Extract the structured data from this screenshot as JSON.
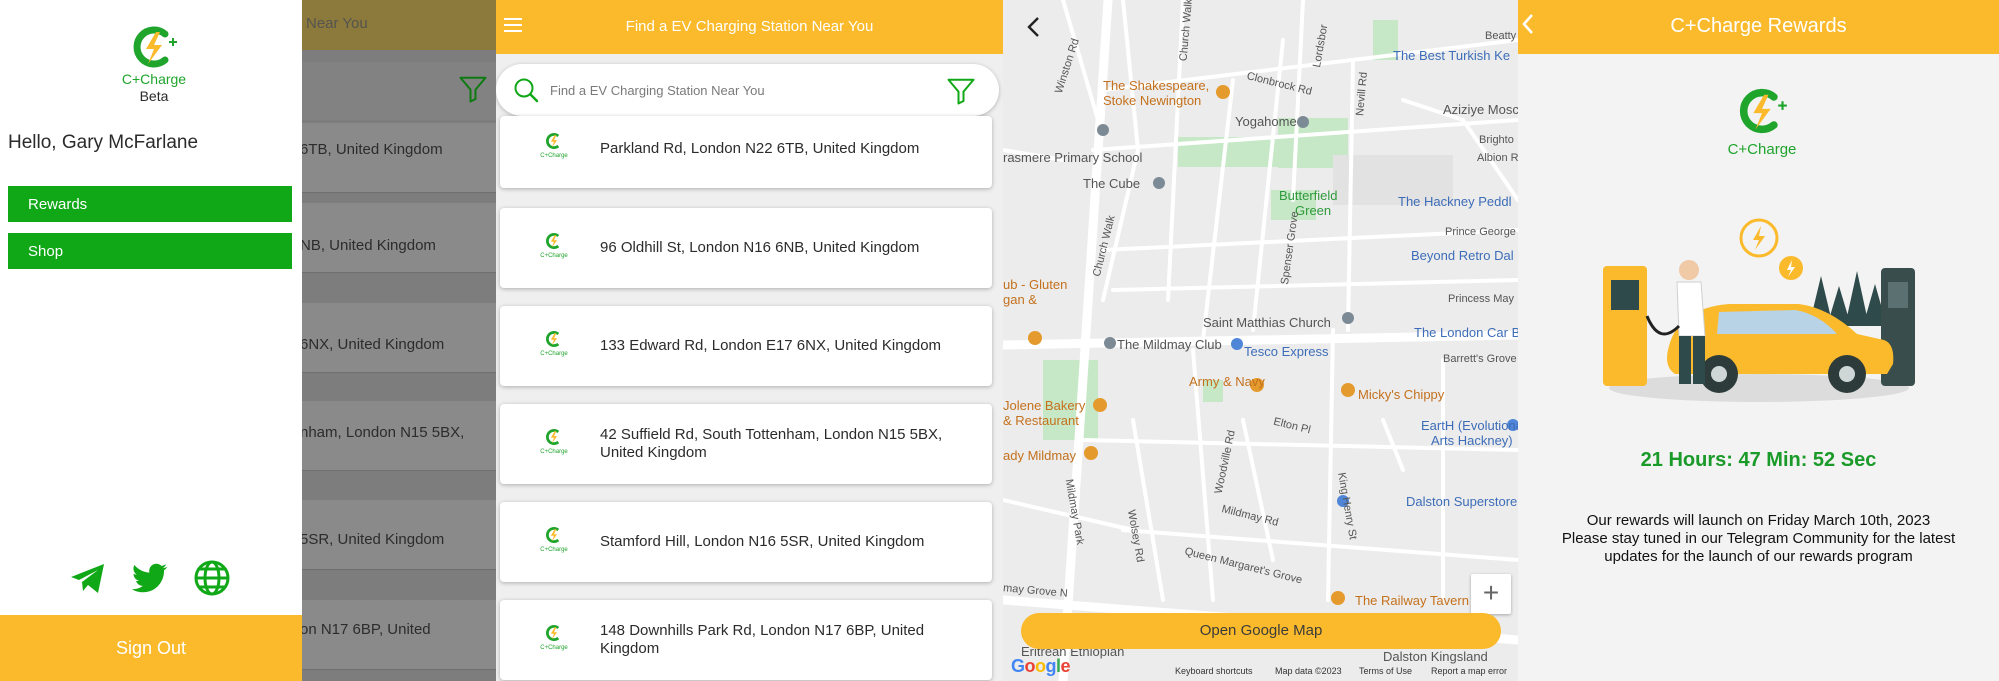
{
  "colors": {
    "accent": "#fbba2b",
    "brand_green": "#11a817",
    "logo_green": "#1fa42c",
    "map_background": "#ececec",
    "park_green": "#c6e8c6"
  },
  "brand": {
    "name": "C+Charge",
    "tag": "Beta"
  },
  "drawer": {
    "greeting": "Hello, Gary McFarlane",
    "menu": [
      {
        "label": "Rewards"
      },
      {
        "label": "Shop"
      }
    ],
    "social_icons": [
      "telegram-icon",
      "twitter-icon",
      "globe-icon"
    ],
    "sign_out": "Sign Out"
  },
  "background_list": {
    "header_fragment": "Near You",
    "items": [
      "6TB, United Kingdom",
      "NB, United Kingdom",
      "6NX, United Kingdom",
      "nham, London N15 5BX,",
      "5SR, United Kingdom",
      "on N17 6BP, United"
    ]
  },
  "list_screen": {
    "title": "Find a EV Charging Station Near You",
    "search_placeholder": "Find a EV Charging Station Near You",
    "stations": [
      {
        "lines": [
          "Parkland Rd, London N22 6TB, United Kingdom"
        ]
      },
      {
        "lines": [
          "96 Oldhill St, London N16 6NB, United Kingdom"
        ]
      },
      {
        "lines": [
          "133 Edward Rd, London E17 6NX, United Kingdom"
        ]
      },
      {
        "lines": [
          "42 Suffield Rd, South Tottenham, London N15 5BX,",
          "United Kingdom"
        ]
      },
      {
        "lines": [
          "Stamford Hill, London N16 5SR, United Kingdom"
        ]
      },
      {
        "lines": [
          "148 Downhills Park Rd, London N17 6BP, United",
          "Kingdom"
        ]
      }
    ]
  },
  "map_screen": {
    "labels": {
      "best_turkish": "The Best Turkish Ke",
      "shakespeare_1": "The Shakespeare,",
      "shakespeare_2": "Stoke Newington",
      "yogahome": "Yogahome",
      "aziziye": "Aziziye Mosc",
      "grasmere": "rasmere Primary School",
      "the_cube": "The Cube",
      "butterfield_1": "Butterfield",
      "butterfield_2": "Green",
      "hackney_peddler": "The Hackney Peddl",
      "beyond_retro": "Beyond Retro Dal",
      "gluten_1": "ub - Gluten",
      "gluten_2": "gan &",
      "saint_matthias": "Saint Matthias Church",
      "london_car_boot": "The London Car Boot",
      "mildmay_club": "The Mildmay Club",
      "tesco": "Tesco Express",
      "army_navy": "Army & Navy",
      "mickys": "Micky's Chippy",
      "jolene_1": "Jolene Bakery",
      "jolene_2": "& Restaurant",
      "earth_1": "EartH (Evolutionary",
      "earth_2": "Arts Hackney)",
      "lady_mildmay": "ady Mildmay",
      "dalston_superstore": "Dalston Superstore",
      "railway_tavern": "The Railway Tavern",
      "eritrean": "Eritrean Ethiopian",
      "dalston_kingsland": "Dalston Kingsland"
    },
    "streets": {
      "winston": "Winston Rd",
      "church_walk": "Church Walk",
      "clonbrock": "Clonbrock Rd",
      "lordsbor": "Lordsbor",
      "nevill": "Nevill Rd",
      "beatty": "Beatty",
      "brighto": "Brighto",
      "albion": "Albion R",
      "prince_george": "Prince George",
      "spenser": "Spenser Grove",
      "princess_may": "Princess May",
      "barretts": "Barrett's Grove",
      "elton": "Elton Pl",
      "woodville": "Woodville Rd",
      "mildmay_rd": "Mildmay Rd",
      "mildmay_park": "Mildmay Park",
      "wolsey": "Wolsey Rd",
      "king_henry": "King Henry St",
      "queen_margarets": "Queen Margaret's Grove",
      "mildmay_grove": "may Grove N",
      "church_walk_2": "Church Walk"
    },
    "zoom_label": "+",
    "open_map_label": "Open Google Map",
    "google_logo": "Google",
    "footer": {
      "shortcuts": "Keyboard shortcuts",
      "map_data": "Map data ©2023",
      "terms": "Terms of Use",
      "report": "Report a map error"
    }
  },
  "rewards_screen": {
    "title": "C+Charge Rewards",
    "countdown": "21 Hours: 47 Min: 52 Sec",
    "notice_lines": [
      "Our rewards will launch on Friday March 10th, 2023",
      "Please stay tuned in our Telegram Community for the latest",
      "updates for the launch of our rewards program"
    ]
  }
}
